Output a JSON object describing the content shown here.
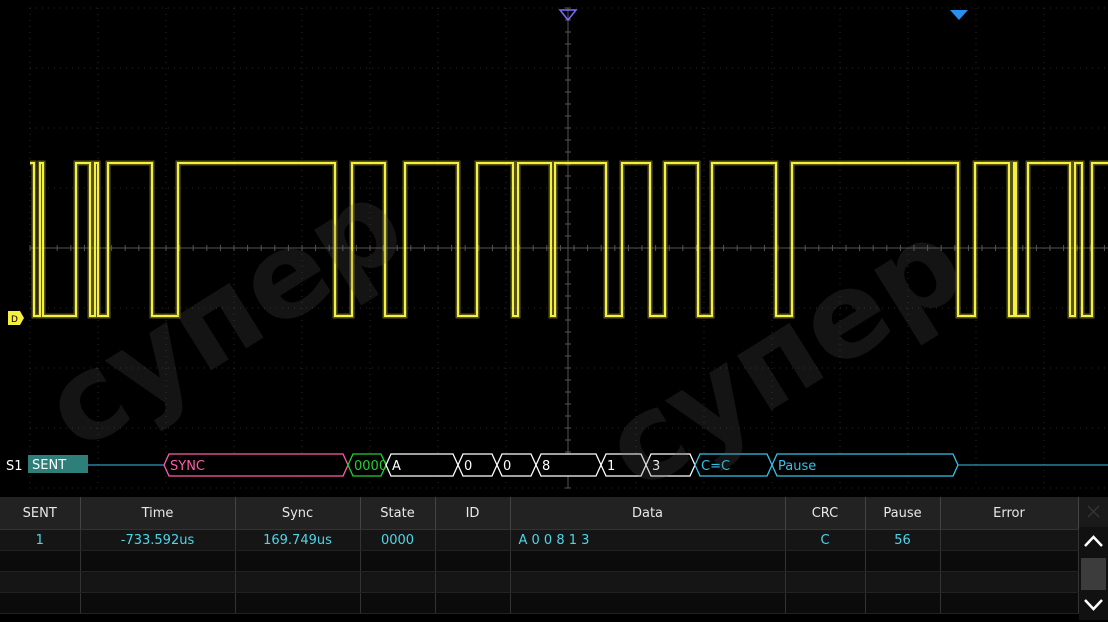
{
  "scope": {
    "trace_color": "#f5ef3d",
    "channel_marker": "D",
    "bus_label": "S1",
    "protocol_label": "SENT",
    "decode_fields": [
      {
        "text": "SYNC",
        "color": "#ff5ca8"
      },
      {
        "text": "0000",
        "color": "#22d12a"
      },
      {
        "text": "A",
        "color": "#ffffff"
      },
      {
        "text": "0",
        "color": "#ffffff"
      },
      {
        "text": "0",
        "color": "#ffffff"
      },
      {
        "text": "8",
        "color": "#ffffff"
      },
      {
        "text": "1",
        "color": "#ffffff"
      },
      {
        "text": "3",
        "color": "#ffffff"
      },
      {
        "text": "C=C",
        "color": "#35c2ea"
      },
      {
        "text": "Pause",
        "color": "#35c2ea"
      }
    ]
  },
  "table": {
    "headers": [
      "SENT",
      "Time",
      "Sync",
      "State",
      "ID",
      "Data",
      "CRC",
      "Pause",
      "Error"
    ],
    "rows": [
      [
        "1",
        "-733.592us",
        "169.749us",
        "0000",
        "",
        "A 0 0 8 1 3",
        "C",
        "56",
        ""
      ],
      [
        "",
        "",
        "",
        "",
        "",
        "",
        "",
        "",
        ""
      ],
      [
        "",
        "",
        "",
        "",
        "",
        "",
        "",
        "",
        ""
      ],
      [
        "",
        "",
        "",
        "",
        "",
        "",
        "",
        "",
        ""
      ]
    ]
  },
  "scrollbar": {
    "up_icon": "chevron-up-icon",
    "down_icon": "chevron-down-icon",
    "close_icon": "close-icon"
  },
  "watermark": "супер айс"
}
